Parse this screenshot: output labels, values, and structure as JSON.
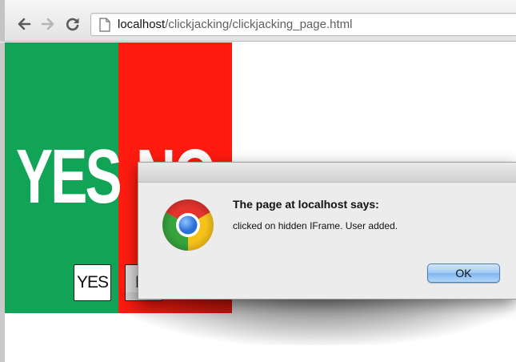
{
  "browser": {
    "url_host": "localhost",
    "url_path": "/clickjacking/clickjacking_page.html",
    "nav": {
      "back_icon": "arrow-left-icon",
      "forward_icon": "arrow-right-icon",
      "reload_icon": "reload-icon",
      "page_icon": "page-icon"
    }
  },
  "page": {
    "big_yes": "YES",
    "big_no": "NO",
    "yes_button": "YES",
    "no_button": "N",
    "colors": {
      "green": "#11a457",
      "red": "#ff1b10"
    }
  },
  "dialog": {
    "title": "The page at localhost says:",
    "message": "clicked on hidden IFrame. User added.",
    "ok_label": "OK",
    "icon": "chrome-logo-icon"
  }
}
